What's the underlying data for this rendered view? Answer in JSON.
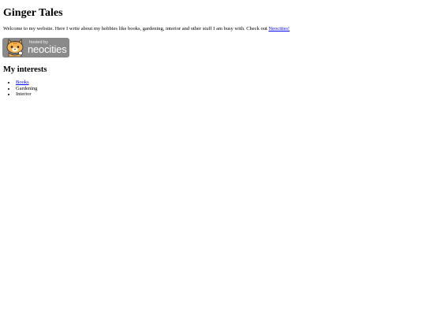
{
  "page": {
    "title": "Ginger Tales",
    "intro_text": "Welcome to my website. Here I write about my hobbies like books, gardening, interior and other stuff I am busy with. Check out ",
    "intro_link": "Neocities!"
  },
  "badge": {
    "small_text": "hosted by",
    "big_text": "neocities",
    "icon": "neocities-cat-icon",
    "background_color": "#8a8a8a"
  },
  "interests": {
    "heading": "My interests",
    "items": [
      {
        "label": "Books",
        "is_link": true
      },
      {
        "label": "Gardening",
        "is_link": false
      },
      {
        "label": "Interior",
        "is_link": false
      }
    ]
  },
  "colors": {
    "link": "#0000ee",
    "text": "#000000",
    "background": "#ffffff"
  }
}
